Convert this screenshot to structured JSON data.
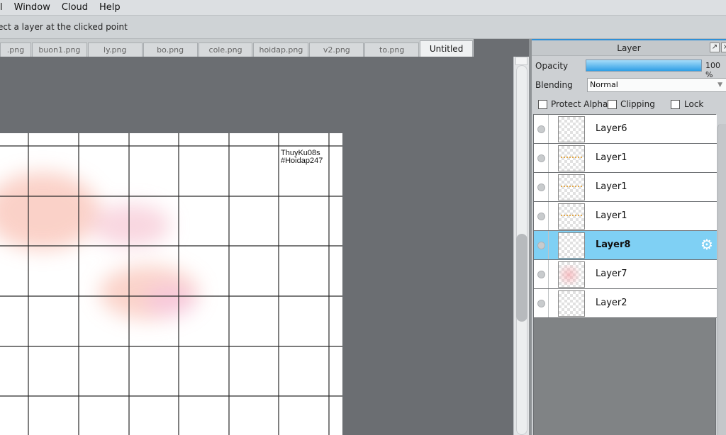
{
  "menubar": {
    "items": [
      "l",
      "Window",
      "Cloud",
      "Help"
    ]
  },
  "hint": {
    "text": "ect a layer at the clicked point"
  },
  "tabs": [
    {
      "label": ".png"
    },
    {
      "label": "buon1.png"
    },
    {
      "label": "ly.png"
    },
    {
      "label": "bo.png"
    },
    {
      "label": "cole.png"
    },
    {
      "label": "hoidap.png"
    },
    {
      "label": "v2.png"
    },
    {
      "label": "to.png"
    },
    {
      "label": "Untitled",
      "active": true
    }
  ],
  "canvas": {
    "note_line1": "ThuyKu08s",
    "note_line2": "#Hoidap247"
  },
  "layer_panel": {
    "title": "Layer",
    "opacity_label": "Opacity",
    "opacity_value": "100 %",
    "opacity_level": 1.0,
    "blending_label": "Blending",
    "blending_value": "Normal",
    "protect_alpha_label": "Protect Alpha",
    "clipping_label": "Clipping",
    "lock_label": "Lock",
    "layers": [
      {
        "name": "Layer6",
        "thumb": "empty"
      },
      {
        "name": "Layer1",
        "thumb": "marks"
      },
      {
        "name": "Layer1",
        "thumb": "marks"
      },
      {
        "name": "Layer1",
        "thumb": "marks"
      },
      {
        "name": "Layer8",
        "thumb": "empty",
        "selected": true
      },
      {
        "name": "Layer7",
        "thumb": "pink"
      },
      {
        "name": "Layer2",
        "thumb": "empty"
      }
    ]
  },
  "colors": {
    "selected_layer": "#7fd0f4",
    "panel_accent": "#2f8fd6",
    "canvas_background": "#6b6e72"
  }
}
